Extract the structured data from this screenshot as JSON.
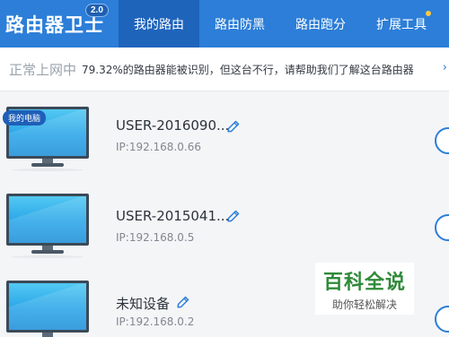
{
  "app": {
    "title": "路由器卫士",
    "version": "2.0"
  },
  "nav": {
    "tabs": [
      {
        "label": "我的路由",
        "active": true
      },
      {
        "label": "路由防黑",
        "active": false
      },
      {
        "label": "路由跑分",
        "active": false
      },
      {
        "label": "扩展工具",
        "active": false,
        "has_dot": true
      }
    ]
  },
  "status": {
    "label": "正常上网中",
    "message": "79.32%的路由器能被识别，但这台不行，请帮助我们了解这台路由器",
    "more": "›"
  },
  "devices": [
    {
      "badge": "我的电脑",
      "name": "USER-2016090...",
      "ip": "IP:192.168.0.66"
    },
    {
      "badge": "",
      "name": "USER-2015041...",
      "ip": "IP:192.168.0.5"
    },
    {
      "badge": "",
      "name": "未知设备",
      "ip": "IP:192.168.0.2"
    }
  ],
  "watermark": {
    "main": "百科全说",
    "sub": "助你轻松解决"
  },
  "colors": {
    "primary": "#2c7ed8",
    "active_tab": "#1f64bb",
    "badge": "#1f5fb8",
    "screen": "#29a5e8"
  }
}
